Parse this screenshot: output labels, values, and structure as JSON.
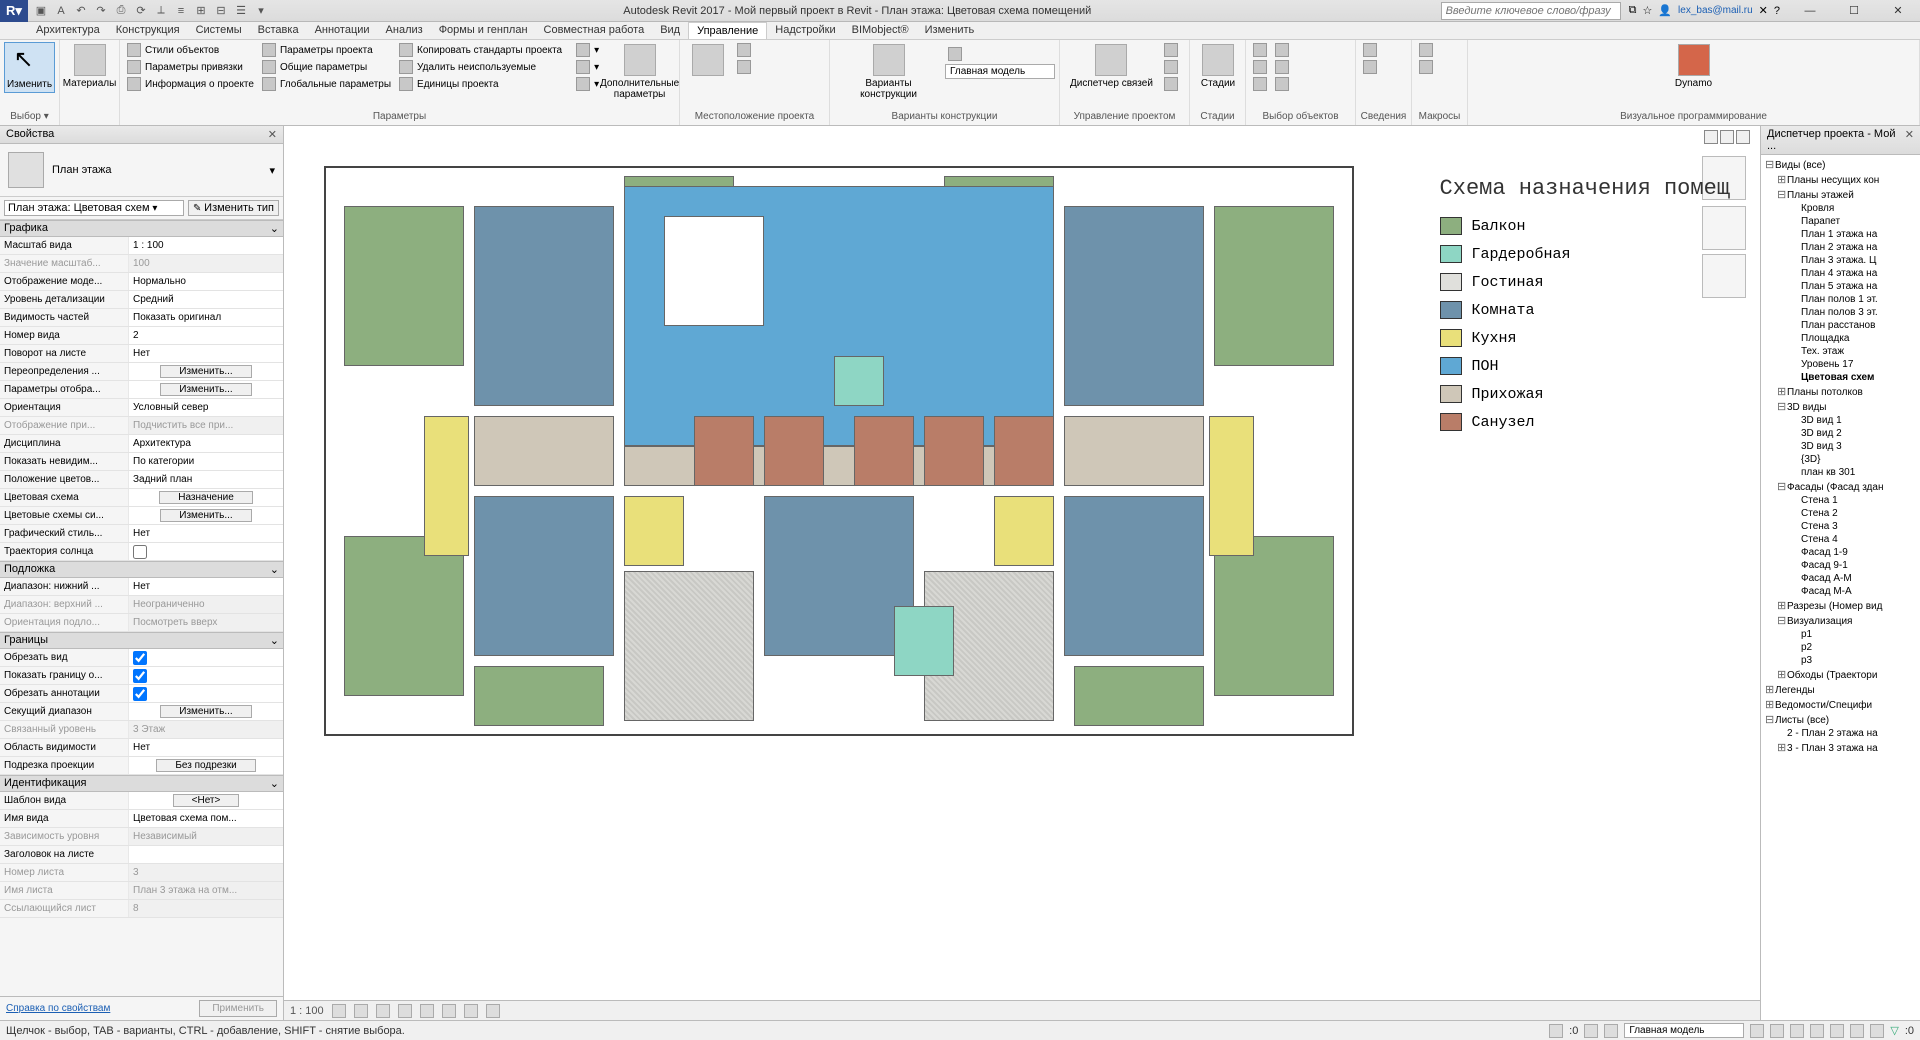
{
  "title": "Autodesk Revit 2017 -    Мой первый проект в Revit - План этажа: Цветовая схема помещений",
  "search_placeholder": "Введите ключевое слово/фразу",
  "user": "lex_bas@mail.ru",
  "menu": [
    "Архитектура",
    "Конструкция",
    "Системы",
    "Вставка",
    "Аннотации",
    "Анализ",
    "Формы и генплан",
    "Совместная работа",
    "Вид",
    "Управление",
    "Надстройки",
    "BIMobject®",
    "Изменить"
  ],
  "menu_active": "Управление",
  "ribbon": {
    "selection": {
      "modify": "Изменить",
      "materials": "Материалы",
      "panel": "Выбор ▾"
    },
    "params": {
      "styles": "Стили объектов",
      "snap": "Параметры привязки",
      "info": "Информация о проекте",
      "proj": "Параметры проекта",
      "shared": "Общие параметры",
      "global": "Глобальные  параметры",
      "copy": "Копировать стандарты проекта",
      "purge": "Удалить неиспользуемые",
      "units": "Единицы проекта",
      "panel": "Параметры"
    },
    "add": {
      "big": "Дополнительные\nпараметры"
    },
    "loc": {
      "panel": "Местоположение проекта"
    },
    "design": {
      "big": "Варианты\nконструкции",
      "main": "Главная модель",
      "panel": "Варианты конструкции"
    },
    "proj": {
      "big": "Диспетчер\nсвязей",
      "panel": "Управление проектом"
    },
    "stages": {
      "big": "Стадии",
      "panel": "Стадии"
    },
    "selpanel": {
      "panel": "Выбор объектов"
    },
    "info": {
      "panel": "Сведения"
    },
    "macros": {
      "panel": "Макросы"
    },
    "dynamo": {
      "big": "Dynamo",
      "panel": "Визуальное программирование"
    }
  },
  "props": {
    "title": "Свойства",
    "type": "План этажа",
    "instance": "План этажа: Цветовая схем",
    "edit_type": "Изменить тип",
    "groups": [
      {
        "name": "Графика",
        "rows": [
          {
            "l": "Масштаб вида",
            "v": "1 : 100"
          },
          {
            "l": "Значение масштаб...",
            "v": "100",
            "d": true
          },
          {
            "l": "Отображение моде...",
            "v": "Нормально"
          },
          {
            "l": "Уровень детализации",
            "v": "Средний"
          },
          {
            "l": "Видимость частей",
            "v": "Показать оригинал"
          },
          {
            "l": "Номер вида",
            "v": "2"
          },
          {
            "l": "Поворот на листе",
            "v": "Нет"
          },
          {
            "l": "Переопределения ...",
            "btn": "Изменить..."
          },
          {
            "l": "Параметры отобра...",
            "btn": "Изменить..."
          },
          {
            "l": "Ориентация",
            "v": "Условный север"
          },
          {
            "l": "Отображение при...",
            "v": "Подчистить все при...",
            "d": true
          },
          {
            "l": "Дисциплина",
            "v": "Архитектура"
          },
          {
            "l": "Показать невидим...",
            "v": "По категории"
          },
          {
            "l": "Положение цветов...",
            "v": "Задний план"
          },
          {
            "l": "Цветовая схема",
            "btn": "Назначение"
          },
          {
            "l": "Цветовые схемы си...",
            "btn": "Изменить..."
          },
          {
            "l": "Графический стиль...",
            "v": "Нет"
          },
          {
            "l": "Траектория солнца",
            "chk": false
          }
        ]
      },
      {
        "name": "Подложка",
        "rows": [
          {
            "l": "Диапазон: нижний ...",
            "v": "Нет"
          },
          {
            "l": "Диапазон: верхний ...",
            "v": "Неограниченно",
            "d": true
          },
          {
            "l": "Ориентация подло...",
            "v": "Посмотреть вверх",
            "d": true
          }
        ]
      },
      {
        "name": "Границы",
        "rows": [
          {
            "l": "Обрезать вид",
            "chk": true
          },
          {
            "l": "Показать границу о...",
            "chk": true
          },
          {
            "l": "Обрезать аннотации",
            "chk": true
          },
          {
            "l": "Секущий диапазон",
            "btn": "Изменить..."
          },
          {
            "l": "Связанный уровень",
            "v": "3 Этаж",
            "d": true
          },
          {
            "l": "Область видимости",
            "v": "Нет"
          },
          {
            "l": "Подрезка проекции",
            "btn": "Без подрезки"
          }
        ]
      },
      {
        "name": "Идентификация",
        "rows": [
          {
            "l": "Шаблон вида",
            "btn": "<Нет>"
          },
          {
            "l": "Имя вида",
            "v": "Цветовая схема пом..."
          },
          {
            "l": "Зависимость уровня",
            "v": "Независимый",
            "d": true
          },
          {
            "l": "Заголовок на листе",
            "v": ""
          },
          {
            "l": "Номер листа",
            "v": "3",
            "d": true
          },
          {
            "l": "Имя листа",
            "v": "План 3 этажа на отм...",
            "d": true
          },
          {
            "l": "Ссылающийся лист",
            "v": "8",
            "d": true
          }
        ]
      }
    ],
    "help": "Справка по свойствам",
    "apply": "Применить"
  },
  "legend": {
    "title": "Схема назначения помещ",
    "items": [
      {
        "c": "c-balkon",
        "t": "Балкон"
      },
      {
        "c": "c-garder",
        "t": "Гардеробная"
      },
      {
        "c": "c-gost",
        "t": "Гостиная"
      },
      {
        "c": "c-komnata",
        "t": "Комната"
      },
      {
        "c": "c-kuhnya",
        "t": "Кухня"
      },
      {
        "c": "c-pon",
        "t": "ПОН"
      },
      {
        "c": "c-prih",
        "t": "Прихожая"
      },
      {
        "c": "c-sanuzel",
        "t": "Санузел"
      }
    ]
  },
  "browser": {
    "title": "Диспетчер проекта - Мой ...",
    "tree": [
      {
        "t": "Виды (все)",
        "l": 0,
        "e": "⊟"
      },
      {
        "t": "Планы несущих кон",
        "l": 1,
        "e": "⊞"
      },
      {
        "t": "Планы этажей",
        "l": 1,
        "e": "⊟"
      },
      {
        "t": "Кровля",
        "l": 2
      },
      {
        "t": "Парапет",
        "l": 2
      },
      {
        "t": "План 1 этажа на",
        "l": 2
      },
      {
        "t": "План 2 этажа на",
        "l": 2
      },
      {
        "t": "План 3 этажа. Ц",
        "l": 2
      },
      {
        "t": "План 4 этажа на",
        "l": 2
      },
      {
        "t": "План 5 этажа на",
        "l": 2
      },
      {
        "t": "План полов 1 эт.",
        "l": 2
      },
      {
        "t": "План полов 3 эт.",
        "l": 2
      },
      {
        "t": "План расстанов",
        "l": 2
      },
      {
        "t": "Площадка",
        "l": 2
      },
      {
        "t": "Тех. этаж",
        "l": 2
      },
      {
        "t": "Уровень 17",
        "l": 2
      },
      {
        "t": "Цветовая схем",
        "l": 2,
        "b": true
      },
      {
        "t": "Планы потолков",
        "l": 1,
        "e": "⊞"
      },
      {
        "t": "3D виды",
        "l": 1,
        "e": "⊟"
      },
      {
        "t": "3D вид 1",
        "l": 2
      },
      {
        "t": "3D вид 2",
        "l": 2
      },
      {
        "t": "3D вид 3",
        "l": 2
      },
      {
        "t": "{3D}",
        "l": 2
      },
      {
        "t": "план кв 301",
        "l": 2
      },
      {
        "t": "Фасады (Фасад здан",
        "l": 1,
        "e": "⊟"
      },
      {
        "t": "Стена 1",
        "l": 2
      },
      {
        "t": "Стена 2",
        "l": 2
      },
      {
        "t": "Стена 3",
        "l": 2
      },
      {
        "t": "Стена 4",
        "l": 2
      },
      {
        "t": "Фасад 1-9",
        "l": 2
      },
      {
        "t": "Фасад 9-1",
        "l": 2
      },
      {
        "t": "Фасад А-М",
        "l": 2
      },
      {
        "t": "Фасад М-А",
        "l": 2
      },
      {
        "t": "Разрезы (Номер вид",
        "l": 1,
        "e": "⊞"
      },
      {
        "t": "Визуализация",
        "l": 1,
        "e": "⊟"
      },
      {
        "t": "p1",
        "l": 2
      },
      {
        "t": "p2",
        "l": 2
      },
      {
        "t": "p3",
        "l": 2
      },
      {
        "t": "Обходы (Траектори",
        "l": 1,
        "e": "⊞"
      },
      {
        "t": "Легенды",
        "l": 0,
        "e": "⊞"
      },
      {
        "t": "Ведомости/Специфи",
        "l": 0,
        "e": "⊞"
      },
      {
        "t": "Листы (все)",
        "l": 0,
        "e": "⊟"
      },
      {
        "t": "2 - План 2 этажа на",
        "l": 1
      },
      {
        "t": "3 - План 3 этажа на",
        "l": 1,
        "e": "⊞"
      }
    ]
  },
  "viewbar": {
    "scale": "1 : 100"
  },
  "status": {
    "hint": "Щелчок - выбор, TAB - варианты, CTRL - добавление, SHIFT - снятие выбора.",
    "sel": ":0",
    "model": "Главная модель"
  }
}
